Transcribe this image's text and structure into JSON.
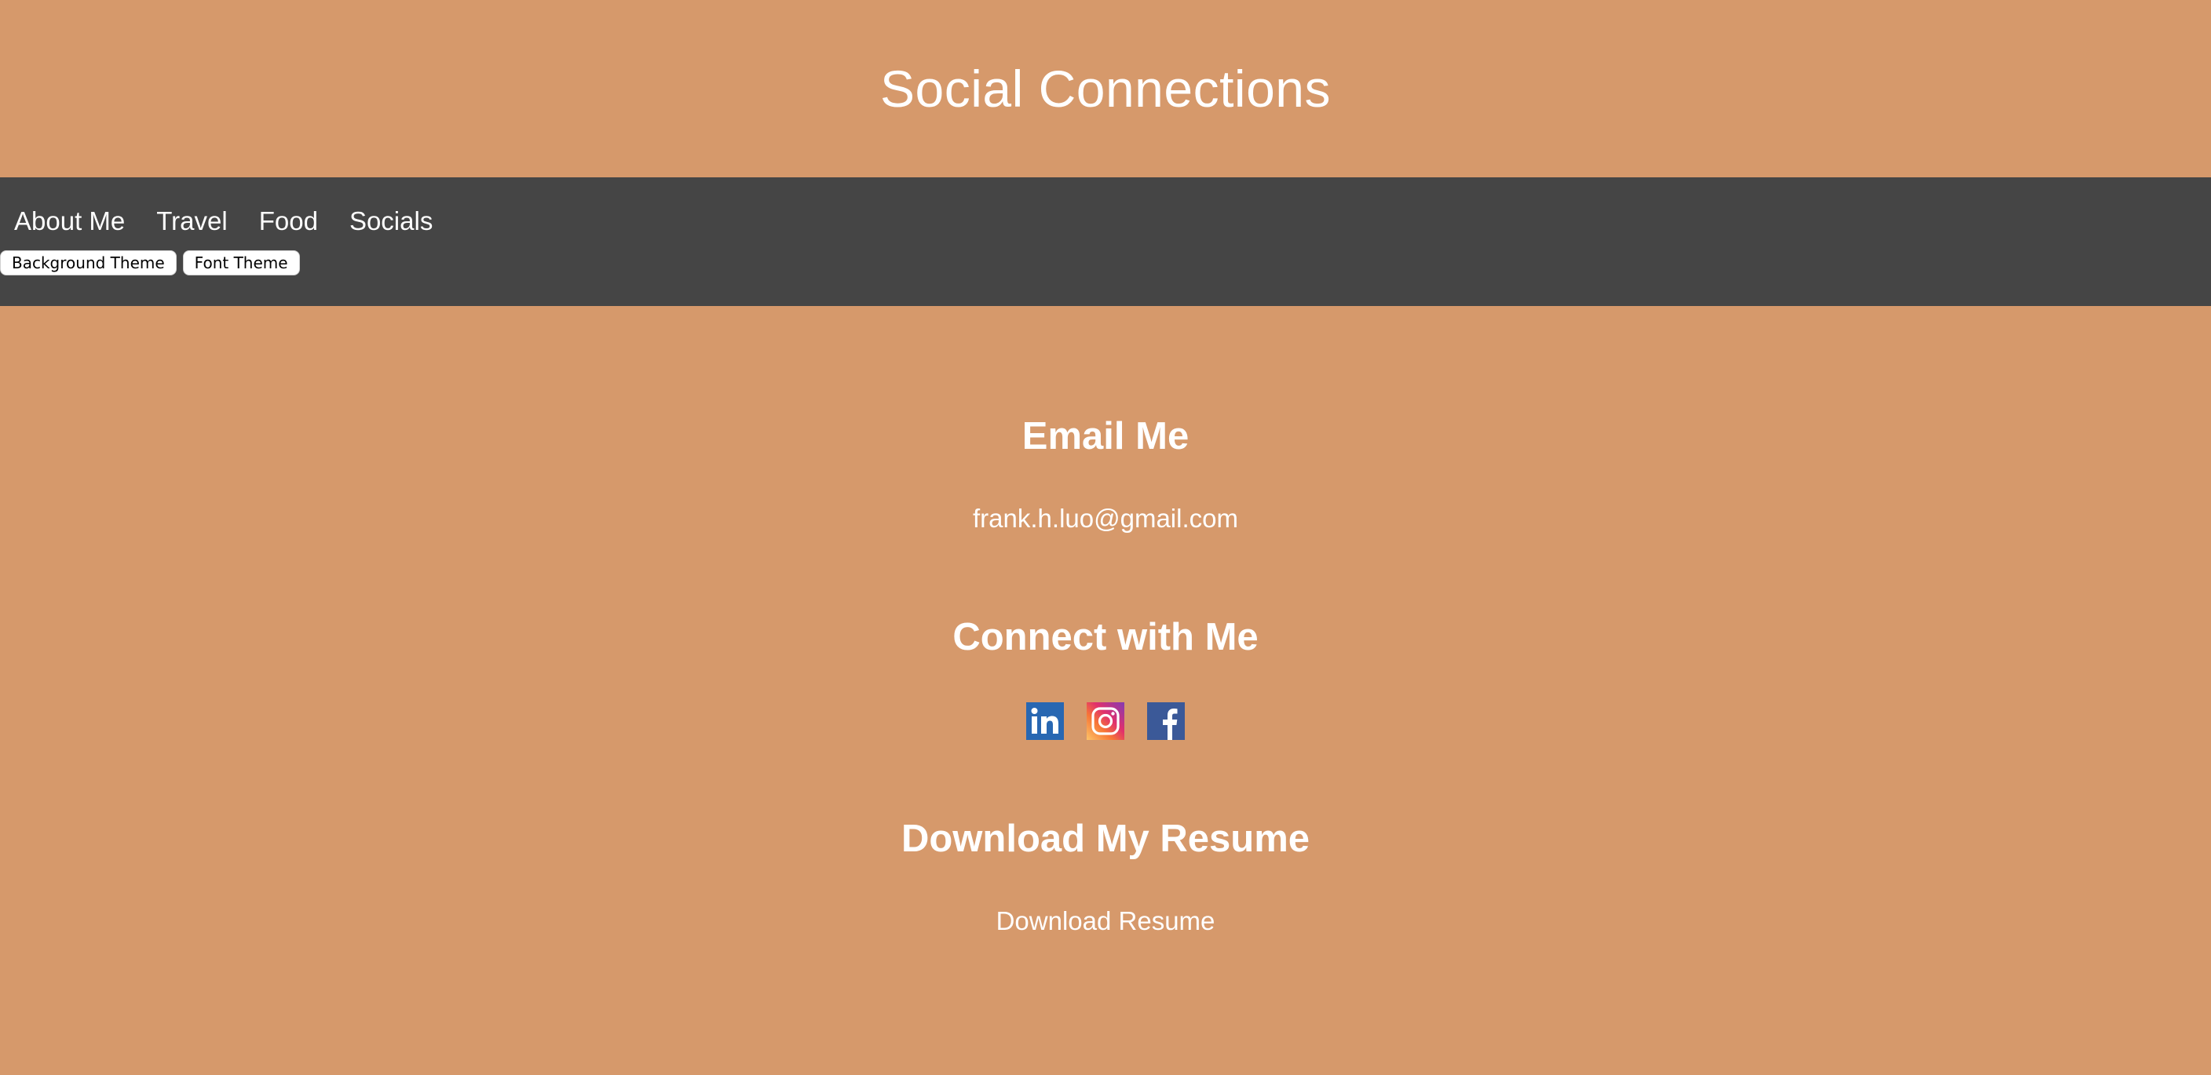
{
  "header": {
    "title": "Social Connections"
  },
  "nav": {
    "items": [
      {
        "label": "About Me"
      },
      {
        "label": "Travel"
      },
      {
        "label": "Food"
      },
      {
        "label": "Socials"
      }
    ],
    "buttons": {
      "background_theme": "Background Theme",
      "font_theme": "Font Theme"
    }
  },
  "email_section": {
    "heading": "Email Me",
    "email": "frank.h.luo@gmail.com"
  },
  "connect_section": {
    "heading": "Connect with Me",
    "icons": [
      "linkedin-icon",
      "instagram-icon",
      "facebook-icon"
    ]
  },
  "resume_section": {
    "heading": "Download My Resume",
    "link_label": "Download Resume"
  },
  "colors": {
    "background": "#d6996b",
    "navbar": "#454545",
    "text": "#ffffff",
    "linkedin": "#2867b2",
    "facebook": "#3b5998"
  }
}
